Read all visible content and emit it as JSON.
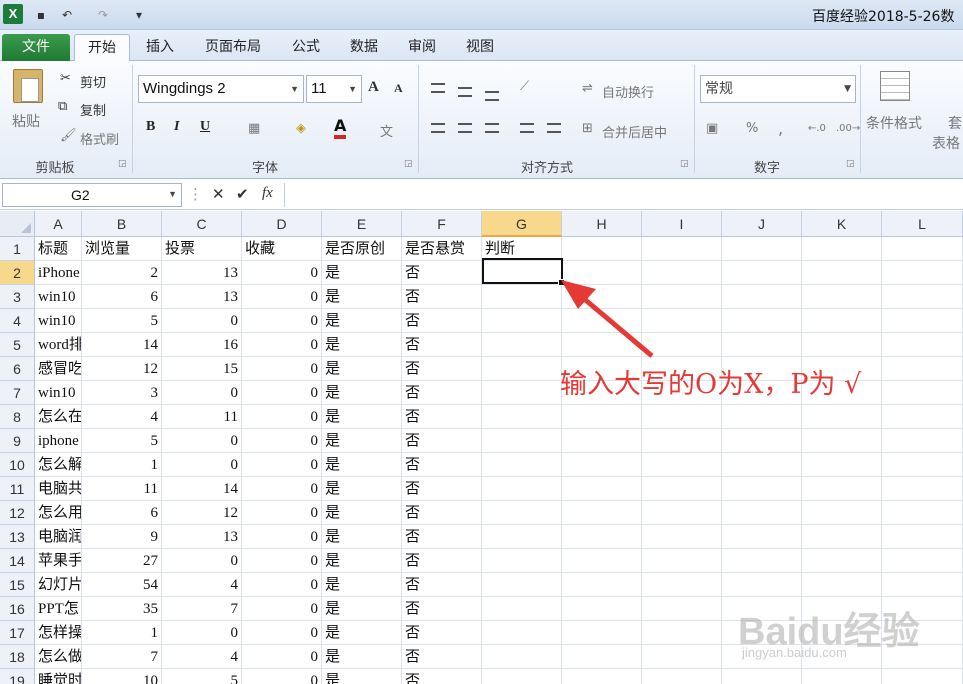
{
  "app": {
    "logo_letter": "X",
    "title": "百度经验2018-5-26数",
    "qat": {
      "save": "▪",
      "undo": "↶",
      "redo": "↷",
      "customize": "▾"
    }
  },
  "tabs": [
    "文件",
    "开始",
    "插入",
    "页面布局",
    "公式",
    "数据",
    "审阅",
    "视图"
  ],
  "ribbon": {
    "clipboard": {
      "paste": "粘贴",
      "cut": "剪切",
      "copy": "复制",
      "format_painter": "格式刷",
      "label": "剪贴板"
    },
    "font": {
      "name": "Wingdings 2",
      "size": "11",
      "grow": "A",
      "shrink": "A",
      "bold": "B",
      "italic": "I",
      "underline": "U",
      "label": "字体"
    },
    "alignment": {
      "wrap": "自动换行",
      "merge": "合并后居中",
      "label": "对齐方式"
    },
    "number": {
      "format": "常规",
      "percent": "%",
      "comma": ",",
      "label": "数字"
    },
    "styles": {
      "cond_format": "条件格式",
      "table_format_a": "套",
      "table_format_b": "表格"
    }
  },
  "formula_bar": {
    "name_box": "G2",
    "fx": "fx",
    "cancel": "✕",
    "confirm": "✔",
    "content": ""
  },
  "columns": [
    "A",
    "B",
    "C",
    "D",
    "E",
    "F",
    "G",
    "H",
    "I",
    "J",
    "K",
    "L"
  ],
  "selected_column": "G",
  "selected_row": "2",
  "rows": [
    {
      "n": "1",
      "A": "标题",
      "B": "浏览量",
      "C": "投票",
      "D": "收藏",
      "E": "是否原创",
      "F": "是否悬赏",
      "G": "判断"
    },
    {
      "n": "2",
      "A": "iPhone",
      "B": "2",
      "C": "13",
      "D": "0",
      "E": "是",
      "F": "否",
      "G": ""
    },
    {
      "n": "3",
      "A": "win10",
      "B": "6",
      "C": "13",
      "D": "0",
      "E": "是",
      "F": "否",
      "G": ""
    },
    {
      "n": "4",
      "A": "win10",
      "B": "5",
      "C": "0",
      "D": "0",
      "E": "是",
      "F": "否",
      "G": ""
    },
    {
      "n": "5",
      "A": "word排",
      "B": "14",
      "C": "16",
      "D": "0",
      "E": "是",
      "F": "否",
      "G": ""
    },
    {
      "n": "6",
      "A": "感冒吃",
      "B": "12",
      "C": "15",
      "D": "0",
      "E": "是",
      "F": "否",
      "G": ""
    },
    {
      "n": "7",
      "A": "win10",
      "B": "3",
      "C": "0",
      "D": "0",
      "E": "是",
      "F": "否",
      "G": ""
    },
    {
      "n": "8",
      "A": "怎么在",
      "B": "4",
      "C": "11",
      "D": "0",
      "E": "是",
      "F": "否",
      "G": ""
    },
    {
      "n": "9",
      "A": "iphone",
      "B": "5",
      "C": "0",
      "D": "0",
      "E": "是",
      "F": "否",
      "G": ""
    },
    {
      "n": "10",
      "A": "怎么解",
      "B": "1",
      "C": "0",
      "D": "0",
      "E": "是",
      "F": "否",
      "G": ""
    },
    {
      "n": "11",
      "A": "电脑共",
      "B": "11",
      "C": "14",
      "D": "0",
      "E": "是",
      "F": "否",
      "G": ""
    },
    {
      "n": "12",
      "A": "怎么用",
      "B": "6",
      "C": "12",
      "D": "0",
      "E": "是",
      "F": "否",
      "G": ""
    },
    {
      "n": "13",
      "A": "电脑润",
      "B": "9",
      "C": "13",
      "D": "0",
      "E": "是",
      "F": "否",
      "G": ""
    },
    {
      "n": "14",
      "A": "苹果手",
      "B": "27",
      "C": "0",
      "D": "0",
      "E": "是",
      "F": "否",
      "G": ""
    },
    {
      "n": "15",
      "A": "幻灯片",
      "B": "54",
      "C": "4",
      "D": "0",
      "E": "是",
      "F": "否",
      "G": ""
    },
    {
      "n": "16",
      "A": "PPT怎",
      "B": "35",
      "C": "7",
      "D": "0",
      "E": "是",
      "F": "否",
      "G": ""
    },
    {
      "n": "17",
      "A": "怎样操",
      "B": "1",
      "C": "0",
      "D": "0",
      "E": "是",
      "F": "否",
      "G": ""
    },
    {
      "n": "18",
      "A": "怎么做",
      "B": "7",
      "C": "4",
      "D": "0",
      "E": "是",
      "F": "否",
      "G": ""
    },
    {
      "n": "19",
      "A": "睡觉时",
      "B": "10",
      "C": "5",
      "D": "0",
      "E": "是",
      "F": "否",
      "G": ""
    }
  ],
  "annotation": {
    "text": "输入大写的O为X，P为 √",
    "color": "#e53935"
  },
  "watermark": {
    "brand": "Baidu经验",
    "url": "jingyan.baidu.com"
  },
  "colors": {
    "file_tab": "#1f7a33",
    "selected_header": "#f8d88a",
    "annotation": "#e53935"
  }
}
